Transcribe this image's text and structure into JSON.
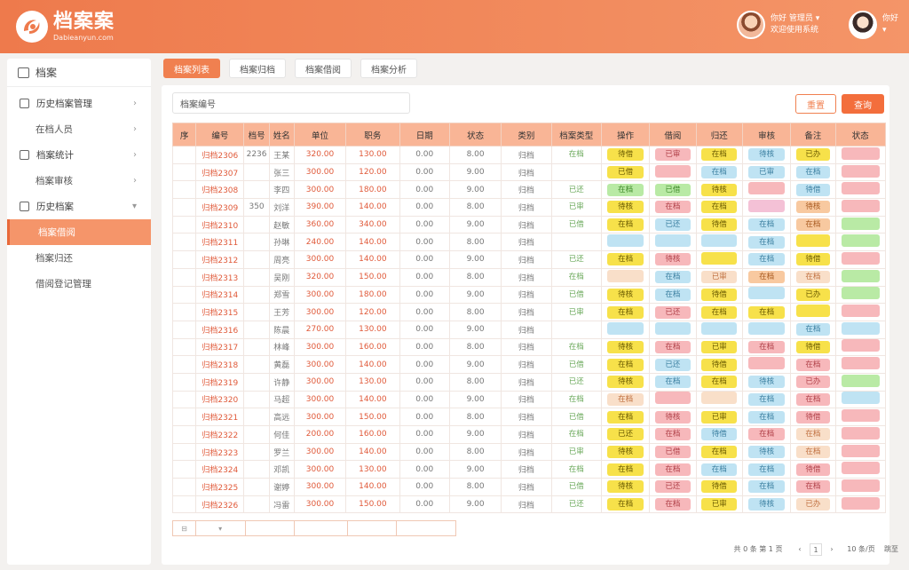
{
  "header": {
    "brand_title": "档案案",
    "brand_sub": "Dabieanyun.com",
    "user1_line1": "你好 管理员 ▾",
    "user1_line2": "欢迎使用系统",
    "user2_line1": "你好",
    "user2_line2": "▾"
  },
  "sidebar": {
    "title": "档案",
    "items": [
      {
        "label": "历史档案管理",
        "level": 1
      },
      {
        "label": "在档人员",
        "level": 2
      },
      {
        "label": "档案统计",
        "level": 1
      },
      {
        "label": "档案审核",
        "level": 2
      },
      {
        "label": "历史档案",
        "level": 1
      },
      {
        "label": "档案借阅",
        "level": 2,
        "active": true
      },
      {
        "label": "档案归还",
        "level": 2
      },
      {
        "label": "借阅登记管理",
        "level": 2
      }
    ]
  },
  "tabs": [
    "档案列表",
    "档案归档",
    "档案借阅",
    "档案分析"
  ],
  "toolbar": {
    "search_placeholder": "档案编号",
    "search_value": "档案编号",
    "reset": "重置",
    "query": "查询"
  },
  "table": {
    "columns": [
      "序",
      "编号",
      "档号",
      "姓名",
      "单位",
      "职务",
      "日期",
      "状态",
      "类别",
      "档案类型",
      "操作",
      "借阅",
      "归还",
      "审核",
      "备注",
      "状态"
    ],
    "rows": [
      [
        "",
        "归档2306",
        "2236",
        "王某",
        "320.00",
        "130.00",
        "0.00",
        "8.00",
        "归档",
        "在档",
        "待借",
        "已审",
        "在档",
        "待核",
        "已办"
      ],
      [
        "",
        "归档2307",
        "",
        "张三",
        "300.00",
        "120.00",
        "0.00",
        "9.00",
        "归档",
        "",
        "已借",
        "",
        "在档",
        "已审",
        "在档"
      ],
      [
        "",
        "归档2308",
        "",
        "李四",
        "300.00",
        "180.00",
        "0.00",
        "9.00",
        "归档",
        "已还",
        "在档",
        "已借",
        "待核",
        "",
        "待借"
      ],
      [
        "",
        "归档2309",
        "350",
        "刘洋",
        "390.00",
        "140.00",
        "0.00",
        "8.00",
        "归档",
        "已审",
        "待核",
        "在档",
        "在档",
        "",
        "待核"
      ],
      [
        "",
        "归档2310",
        "",
        "赵敏",
        "360.00",
        "340.00",
        "0.00",
        "9.00",
        "归档",
        "已借",
        "在档",
        "已还",
        "待借",
        "在档",
        "在档"
      ],
      [
        "",
        "归档2311",
        "",
        "孙琳",
        "240.00",
        "140.00",
        "0.00",
        "8.00",
        "归档",
        "",
        "",
        "",
        "",
        "在档",
        ""
      ],
      [
        "",
        "归档2312",
        "",
        "周亮",
        "300.00",
        "140.00",
        "0.00",
        "9.00",
        "归档",
        "已还",
        "在档",
        "待核",
        "",
        "在档",
        "待借"
      ],
      [
        "",
        "归档2313",
        "",
        "吴刚",
        "320.00",
        "150.00",
        "0.00",
        "8.00",
        "归档",
        "在档",
        "",
        "在档",
        "已审",
        "在档",
        "在档"
      ],
      [
        "",
        "归档2314",
        "",
        "郑雪",
        "300.00",
        "180.00",
        "0.00",
        "9.00",
        "归档",
        "已借",
        "待核",
        "在档",
        "待借",
        "",
        "已办"
      ],
      [
        "",
        "归档2315",
        "",
        "王芳",
        "300.00",
        "120.00",
        "0.00",
        "8.00",
        "归档",
        "已审",
        "在档",
        "已还",
        "在档",
        "在档",
        ""
      ],
      [
        "",
        "归档2316",
        "",
        "陈晨",
        "270.00",
        "130.00",
        "0.00",
        "9.00",
        "归档",
        "",
        "",
        "",
        "",
        "",
        "在档"
      ],
      [
        "",
        "归档2317",
        "",
        "林峰",
        "300.00",
        "160.00",
        "0.00",
        "8.00",
        "归档",
        "在档",
        "待核",
        "在档",
        "已审",
        "在档",
        "待借"
      ],
      [
        "",
        "归档2318",
        "",
        "黄磊",
        "300.00",
        "140.00",
        "0.00",
        "9.00",
        "归档",
        "已借",
        "在档",
        "已还",
        "待借",
        "",
        "在档"
      ],
      [
        "",
        "归档2319",
        "",
        "许静",
        "300.00",
        "130.00",
        "0.00",
        "8.00",
        "归档",
        "已还",
        "待核",
        "在档",
        "在档",
        "待核",
        "已办"
      ],
      [
        "",
        "归档2320",
        "",
        "马超",
        "300.00",
        "140.00",
        "0.00",
        "9.00",
        "归档",
        "在档",
        "在档",
        "",
        "",
        "在档",
        "在档"
      ],
      [
        "",
        "归档2321",
        "",
        "高远",
        "300.00",
        "150.00",
        "0.00",
        "8.00",
        "归档",
        "已借",
        "在档",
        "待核",
        "已审",
        "在档",
        "待借"
      ],
      [
        "",
        "归档2322",
        "",
        "何佳",
        "200.00",
        "160.00",
        "0.00",
        "9.00",
        "归档",
        "在档",
        "已还",
        "在档",
        "待借",
        "在档",
        "在档"
      ],
      [
        "",
        "归档2323",
        "",
        "罗兰",
        "300.00",
        "140.00",
        "0.00",
        "8.00",
        "归档",
        "已审",
        "待核",
        "已借",
        "在档",
        "待核",
        "在档"
      ],
      [
        "",
        "归档2324",
        "",
        "邓凯",
        "300.00",
        "130.00",
        "0.00",
        "9.00",
        "归档",
        "在档",
        "在档",
        "在档",
        "在档",
        "在档",
        "待借"
      ],
      [
        "",
        "归档2325",
        "",
        "谢婷",
        "300.00",
        "140.00",
        "0.00",
        "8.00",
        "归档",
        "已借",
        "待核",
        "已还",
        "待借",
        "在档",
        "在档"
      ],
      [
        "",
        "归档2326",
        "",
        "冯雷",
        "300.00",
        "150.00",
        "0.00",
        "9.00",
        "归档",
        "已还",
        "在档",
        "在档",
        "已审",
        "待核",
        "已办"
      ]
    ],
    "tag_colors": [
      [
        "y",
        "p",
        "y",
        "b",
        "y",
        "p",
        "b"
      ],
      [
        "y",
        "p",
        "b",
        "b",
        "b",
        "p"
      ],
      [
        "g",
        "g",
        "y",
        "p",
        "b",
        "p"
      ],
      [
        "y",
        "p",
        "y",
        "pk",
        "o",
        "p"
      ],
      [
        "y",
        "b",
        "y",
        "b",
        "o",
        "g"
      ],
      [
        "b",
        "b",
        "b",
        "b",
        "y",
        "g"
      ],
      [
        "y",
        "p",
        "y",
        "b",
        "y",
        "p"
      ],
      [
        "t",
        "b",
        "t",
        "o",
        "t",
        "g"
      ],
      [
        "y",
        "b",
        "y",
        "b",
        "y",
        "g"
      ],
      [
        "y",
        "p",
        "y",
        "y",
        "y",
        "p"
      ],
      [
        "b",
        "b",
        "b",
        "b",
        "b",
        "b"
      ],
      [
        "y",
        "p",
        "y",
        "p",
        "y",
        "p"
      ],
      [
        "y",
        "b",
        "y",
        "p",
        "p",
        "p"
      ],
      [
        "y",
        "b",
        "y",
        "b",
        "p",
        "g"
      ],
      [
        "t",
        "p",
        "t",
        "b",
        "p",
        "b"
      ],
      [
        "y",
        "p",
        "y",
        "b",
        "p",
        "p"
      ],
      [
        "y",
        "p",
        "b",
        "p",
        "t",
        "p"
      ],
      [
        "y",
        "p",
        "y",
        "b",
        "t",
        "p"
      ],
      [
        "y",
        "p",
        "b",
        "b",
        "p",
        "p"
      ],
      [
        "y",
        "p",
        "y",
        "b",
        "p",
        "p"
      ],
      [
        "y",
        "p",
        "y",
        "b",
        "t",
        "p"
      ]
    ]
  },
  "footer": {
    "select_value": "▾"
  },
  "pager": {
    "summary": "共 0 条 第 1 页",
    "goto": "跳至",
    "page": "1",
    "prev": "‹",
    "next": "›",
    "size": "10 条/页"
  }
}
